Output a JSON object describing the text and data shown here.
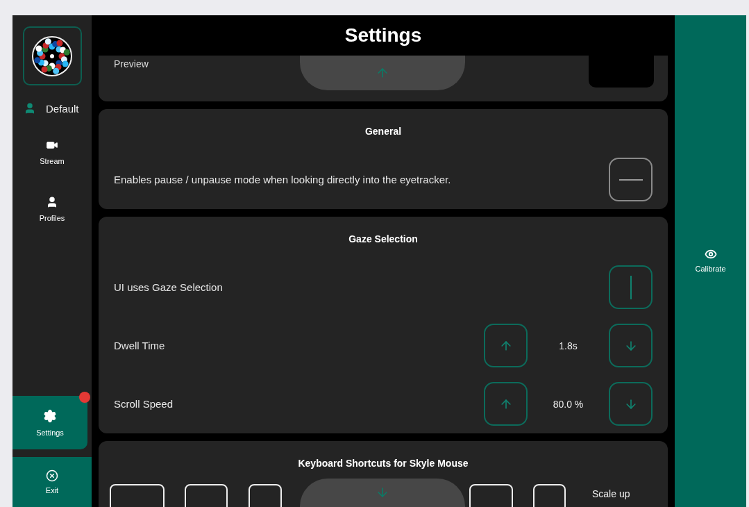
{
  "sidebar": {
    "profile": "Default",
    "nav": [
      {
        "label": "Stream",
        "kind": "video",
        "selected": false,
        "badge": false
      },
      {
        "label": "Profiles",
        "kind": "user",
        "selected": false,
        "badge": false
      },
      {
        "label": "Settings",
        "kind": "gear",
        "selected": true,
        "badge": true
      }
    ],
    "exit": "Exit"
  },
  "header": {
    "title": "Settings"
  },
  "preview": {
    "label": "Preview"
  },
  "sections": [
    {
      "title": "General",
      "rows": [
        {
          "kind": "toggle",
          "label": "Enables pause / unpause mode when looking directly into the eyetracker.",
          "on": false
        }
      ]
    },
    {
      "title": "Gaze Selection",
      "rows": [
        {
          "kind": "toggle",
          "label": "UI uses Gaze Selection",
          "on": true
        },
        {
          "kind": "stepper",
          "label": "Dwell Time",
          "value": "1.8s"
        },
        {
          "kind": "stepper",
          "label": "Scroll Speed",
          "value": "80.0 %"
        }
      ]
    }
  ],
  "shortcuts": {
    "title": "Keyboard Shortcuts for Skyle Mouse",
    "label": "Scale up"
  },
  "right_panel": {
    "action": "Calibrate"
  }
}
